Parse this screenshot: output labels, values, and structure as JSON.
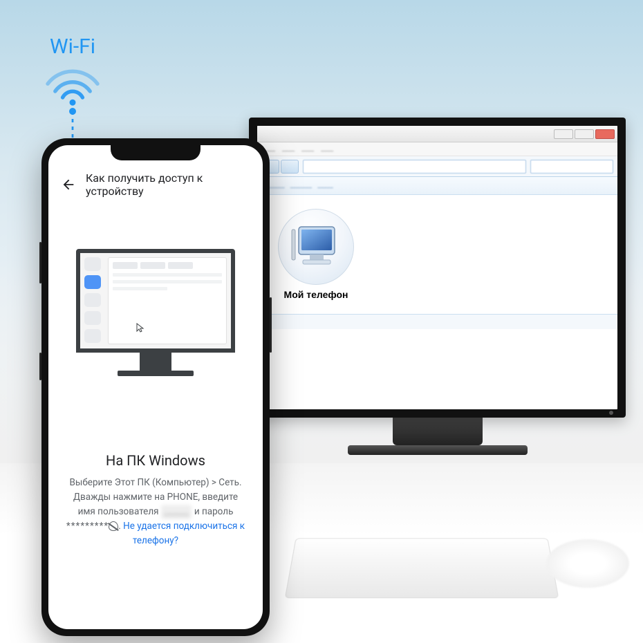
{
  "wifi": {
    "label": "Wi-Fi"
  },
  "monitor": {
    "window": {
      "addressbar_text": "",
      "search_text": "",
      "menu_items": [
        "",
        "",
        "",
        "",
        ""
      ],
      "toolbar_items": [
        "",
        "",
        ""
      ]
    },
    "device": {
      "label": "Мой телефон"
    }
  },
  "phone": {
    "header": {
      "title": "Как получить доступ к устройству"
    },
    "section": {
      "title": "На ПК Windows",
      "text_line1": "Выберите Этот ПК (Компьютер) > Сеть.",
      "text_line2_a": "Дважды нажмите на PHONE, введите имя",
      "text_line3_a": "пользователя",
      "text_line3_user_masked": "______",
      "text_line3_b": "и пароль",
      "text_line3_pass_masked": "*********",
      "text_line3_dot": ".",
      "link": "Не удается подключиться к телефону?"
    }
  }
}
